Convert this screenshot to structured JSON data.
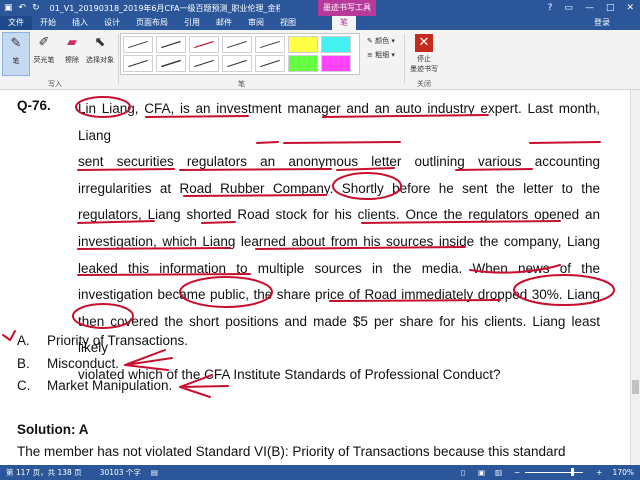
{
  "window": {
    "title": "01_V1_20190318_2019年6月CFA一级百题预测_职业伦理_金程...",
    "context_tab_group": "墨迹书写工具",
    "login": "登录"
  },
  "tabs": [
    "文件",
    "开始",
    "插入",
    "设计",
    "页面布局",
    "引用",
    "邮件",
    "审阅",
    "视图",
    "笔"
  ],
  "ribbon": {
    "tools": {
      "pen": "笔",
      "highlighter": "荧光笔",
      "eraser": "擦除",
      "select_objects": "选择对象"
    },
    "group_write": "写入",
    "group_pens": "笔",
    "color_label": "颜色",
    "thickness_label": "粗细",
    "stop_inking": "停止\n墨迹书写",
    "group_close": "关闭"
  },
  "document": {
    "question_number": "Q-76.",
    "paragraph_lines": [
      "Lin Liang, CFA, is an investment manager and an auto industry expert. Last month, Liang",
      "sent securities regulators an anonymous letter outlining various accounting",
      "irregularities at Road Rubber Company. Shortly before he sent the letter to the",
      "regulators, Liang shorted Road stock for his clients. Once the regulators opened an",
      "investigation, which Liang learned about from his sources inside the company, Liang",
      "leaked this information to multiple sources in the media. When news of the",
      "investigation became public, the share price of Road immediately dropped 30%. Liang",
      "then covered the short positions and made $5 per share for his clients. Liang least likely",
      "violated which of the CFA Institute Standards of Professional Conduct?"
    ],
    "options": [
      {
        "label": "A.",
        "text": "Priority of Transactions."
      },
      {
        "label": "B.",
        "text": "Misconduct."
      },
      {
        "label": "C.",
        "text": "Market Manipulation."
      }
    ],
    "solution": "Solution: A",
    "solution_text": "The member has not violated Standard VI(B): Priority of Transactions because this standard"
  },
  "status": {
    "page": "第 117 页，共 138 页",
    "words": "30103 个字",
    "zoom": "170%"
  },
  "colors": {
    "title_bar": "#2b579a",
    "context_tab": "#b73a9b",
    "ink": "#c8102e"
  }
}
